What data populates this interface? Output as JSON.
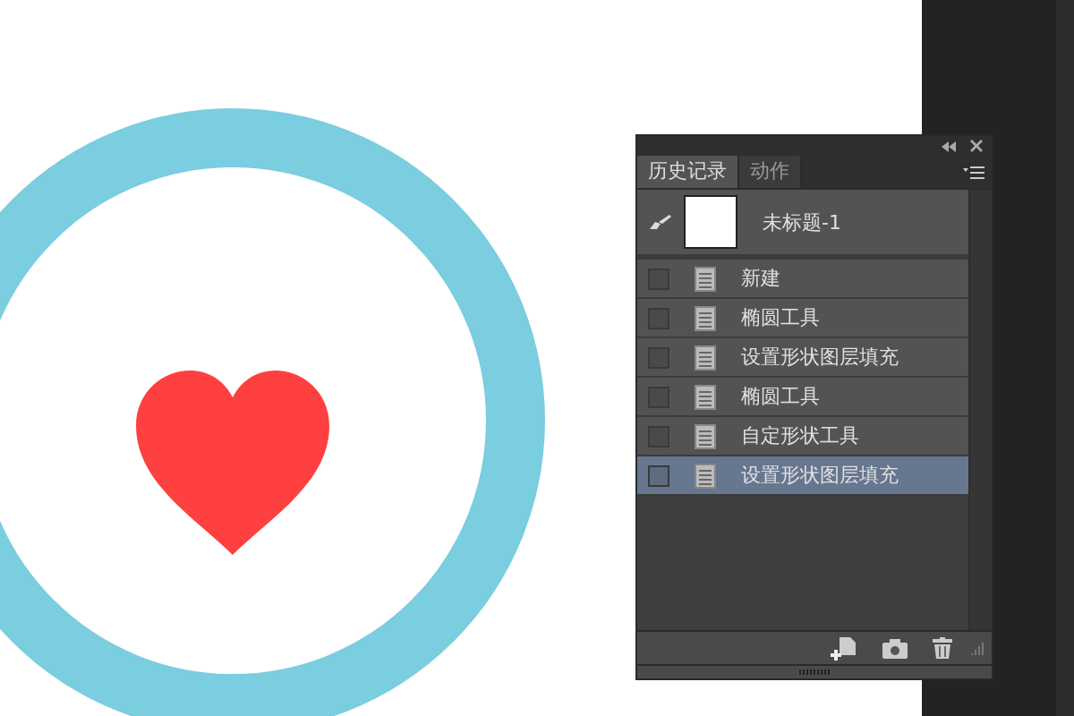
{
  "panel": {
    "tabs": [
      {
        "label": "历史记录",
        "selected": true
      },
      {
        "label": "动作",
        "selected": false
      }
    ],
    "snapshot": {
      "name": "未标题-1"
    },
    "history": [
      {
        "label": "新建",
        "checked": false,
        "selected": false
      },
      {
        "label": "椭圆工具",
        "checked": false,
        "selected": false
      },
      {
        "label": "设置形状图层填充",
        "checked": false,
        "selected": false
      },
      {
        "label": "椭圆工具",
        "checked": false,
        "selected": false
      },
      {
        "label": "自定形状工具",
        "checked": false,
        "selected": false
      },
      {
        "label": "设置形状图层填充",
        "checked": false,
        "selected": true
      }
    ]
  }
}
